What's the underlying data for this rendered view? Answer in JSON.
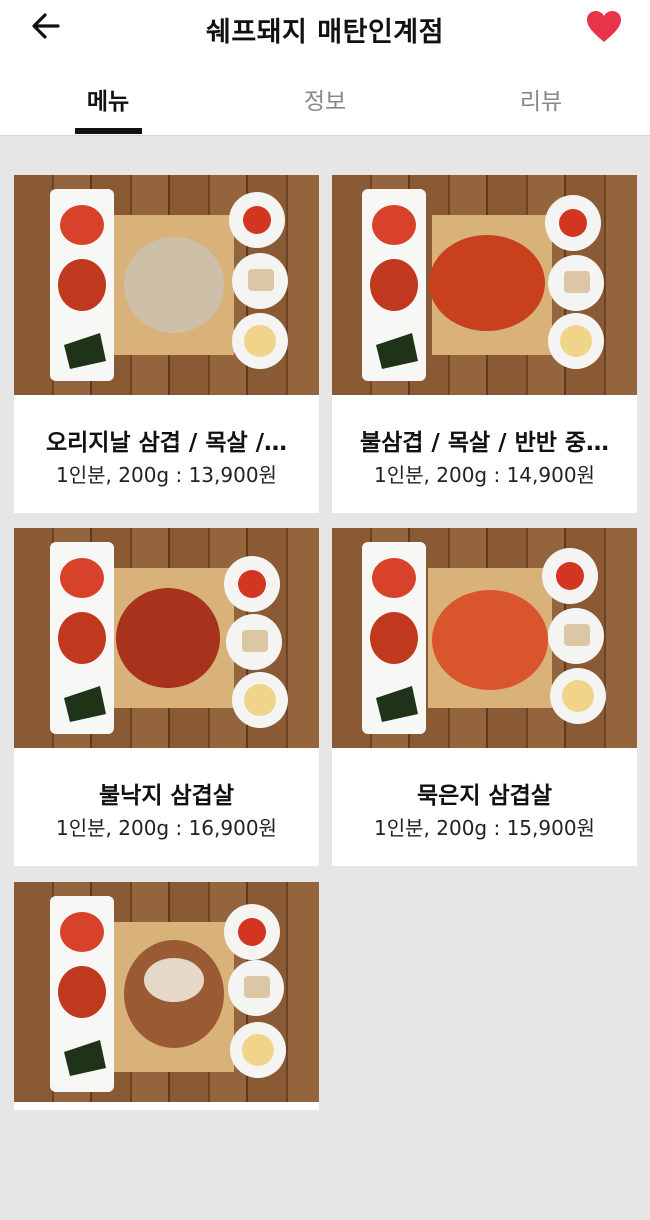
{
  "header": {
    "title": "쉐프돼지 매탄인계점",
    "back_icon": "arrow-left-icon",
    "favorite_icon": "heart-icon",
    "favorite_color": "#e8334a"
  },
  "tabs": [
    {
      "label": "메뉴",
      "active": true
    },
    {
      "label": "정보",
      "active": false
    },
    {
      "label": "리뷰",
      "active": false
    }
  ],
  "menu_items": [
    {
      "name": "오리지날 삼겹 / 목살 /…",
      "price": "1인분, 200g : 13,900원",
      "meat_color": "#cdbfa8"
    },
    {
      "name": "불삼겹 / 목살 / 반반 중…",
      "price": "1인분, 200g : 14,900원",
      "meat_color": "#c9401f"
    },
    {
      "name": "불낙지 삼겹살",
      "price": "1인분, 200g : 16,900원",
      "meat_color": "#a8321c"
    },
    {
      "name": "묵은지 삼겹살",
      "price": "1인분, 200g : 15,900원",
      "meat_color": "#d9552c"
    },
    {
      "name": "",
      "price": "",
      "meat_color": "#9a5a34"
    }
  ]
}
